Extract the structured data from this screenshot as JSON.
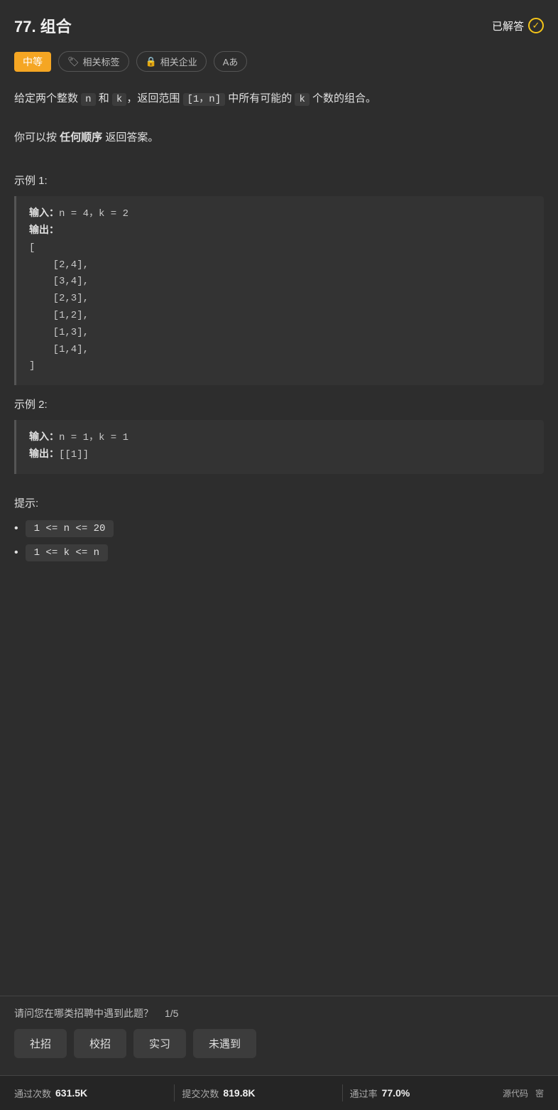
{
  "header": {
    "title": "77. 组合",
    "solved_label": "已解答",
    "solved_icon": "✓"
  },
  "tags": {
    "difficulty": "中等",
    "related_tags_label": "相关标签",
    "related_company_label": "相关企业",
    "font_label": "Aあ"
  },
  "description": {
    "line1_prefix": "给定两个整数 ",
    "n_code": "n",
    "line1_mid1": " 和 ",
    "k_code": "k",
    "line1_mid2": "，返回范围 ",
    "range_code": "[1，n]",
    "line1_mid3": " 中所有可能的 ",
    "k_code2": "k",
    "line1_suffix": " 个数的组合。",
    "line2_prefix": "你可以按 ",
    "bold_text": "任何顺序",
    "line2_suffix": " 返回答案。"
  },
  "examples": [
    {
      "label": "示例 1:",
      "content": "输入：n = 4，k = 2\n输出：\n[\n    [2,4],\n    [3,4],\n    [2,3],\n    [1,2],\n    [1,3],\n    [1,4],\n]"
    },
    {
      "label": "示例 2:",
      "content": "输入：n = 1，k = 1\n输出：[[1]]"
    }
  ],
  "hints": {
    "label": "提示:",
    "items": [
      "1 <= n <= 20",
      "1 <= k <= n"
    ]
  },
  "footer": {
    "question_text": "请问您在哪类招聘中遇到此题？",
    "question_count": "1/5",
    "buttons": [
      "社招",
      "校招",
      "实习",
      "未遇到"
    ]
  },
  "stats": [
    {
      "label": "通过次数",
      "value": "631.5K"
    },
    {
      "label": "提交次数",
      "value": "819.8K"
    },
    {
      "label": "通过率",
      "value": "77.0%"
    }
  ],
  "stats_links": [
    "源代码",
    "宻"
  ]
}
